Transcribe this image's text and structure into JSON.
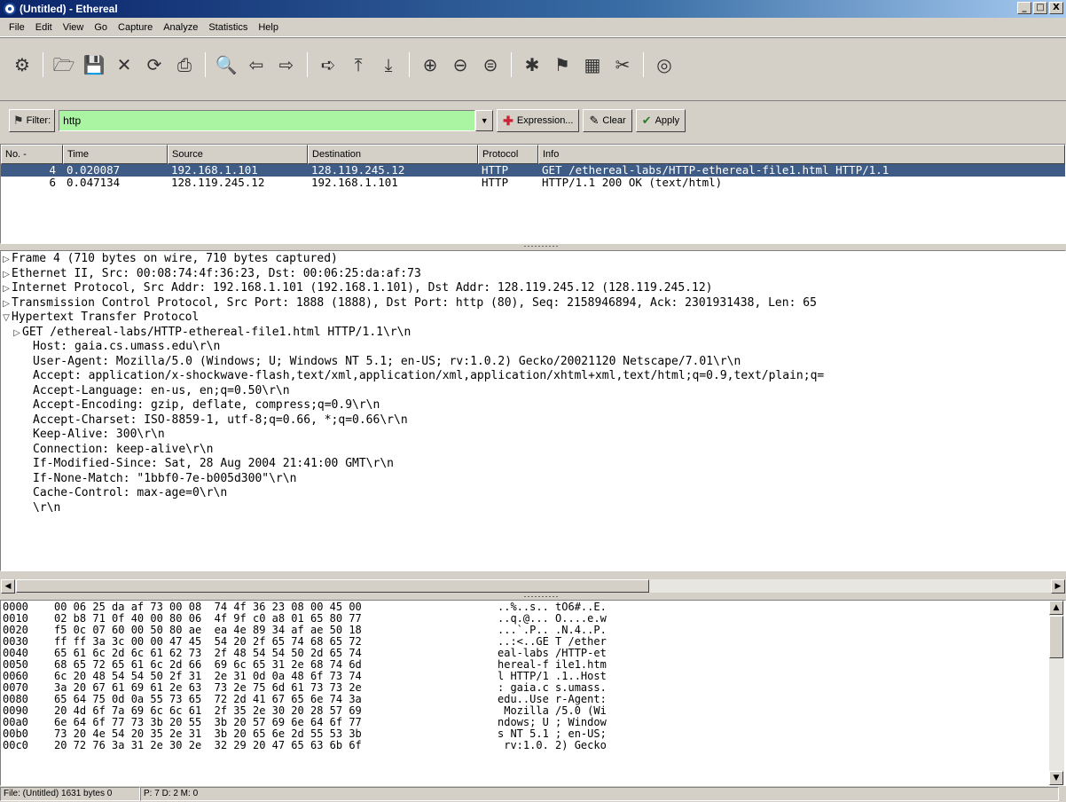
{
  "window": {
    "title": "(Untitled) - Ethereal",
    "buttons": [
      "_",
      "□",
      "X"
    ]
  },
  "menu": [
    "File",
    "Edit",
    "View",
    "Go",
    "Capture",
    "Analyze",
    "Statistics",
    "Help"
  ],
  "toolbar": {
    "icons": [
      {
        "name": "capture-interfaces-icon",
        "glyph": "⚙"
      },
      {
        "sep": true
      },
      {
        "name": "open-folder-icon",
        "glyph": "🗁"
      },
      {
        "name": "save-icon",
        "glyph": "💾"
      },
      {
        "name": "close-icon",
        "glyph": "✕"
      },
      {
        "name": "reload-icon",
        "glyph": "⟳"
      },
      {
        "name": "print-icon",
        "glyph": "⎙"
      },
      {
        "sep": true
      },
      {
        "name": "find-packet-icon",
        "glyph": "🔍"
      },
      {
        "name": "go-back-icon",
        "glyph": "⇦"
      },
      {
        "name": "go-forward-icon",
        "glyph": "⇨"
      },
      {
        "sep": true
      },
      {
        "name": "go-to-packet-icon",
        "glyph": "➪"
      },
      {
        "name": "go-first-icon",
        "glyph": "⤒"
      },
      {
        "name": "go-last-icon",
        "glyph": "⤓"
      },
      {
        "sep": true
      },
      {
        "name": "zoom-in-icon",
        "glyph": "⊕"
      },
      {
        "name": "zoom-out-icon",
        "glyph": "⊖"
      },
      {
        "name": "zoom-normal-icon",
        "glyph": "⊜"
      },
      {
        "sep": true
      },
      {
        "name": "capture-filter-icon",
        "glyph": "✱"
      },
      {
        "name": "display-filter-icon",
        "glyph": "⚑"
      },
      {
        "name": "coloring-rules-icon",
        "glyph": "▦"
      },
      {
        "name": "preferences-icon",
        "glyph": "✂"
      },
      {
        "sep": true
      },
      {
        "name": "help-icon",
        "glyph": "◎"
      }
    ]
  },
  "filter": {
    "label": "Filter:",
    "value": "http",
    "expression_label": "Expression...",
    "clear_label": "Clear",
    "apply_label": "Apply",
    "input_color": "#a9f5a2"
  },
  "packet_list": {
    "columns": [
      "No. -",
      "Time",
      "Source",
      "Destination",
      "Protocol",
      "Info"
    ],
    "rows": [
      {
        "no": "4",
        "time": "0.020087",
        "src": "192.168.1.101",
        "dst": "128.119.245.12",
        "proto": "HTTP",
        "info": "GET /ethereal-labs/HTTP-ethereal-file1.html HTTP/1.1",
        "selected": true
      },
      {
        "no": "6",
        "time": "0.047134",
        "src": "128.119.245.12",
        "dst": "192.168.1.101",
        "proto": "HTTP",
        "info": "HTTP/1.1 200 OK (text/html)",
        "selected": false
      }
    ],
    "selected_color": "#3e5c86"
  },
  "details": [
    {
      "tri": "▷",
      "indent": 0,
      "text": "Frame 4 (710 bytes on wire, 710 bytes captured)"
    },
    {
      "tri": "▷",
      "indent": 0,
      "text": "Ethernet II, Src: 00:08:74:4f:36:23, Dst: 00:06:25:da:af:73"
    },
    {
      "tri": "▷",
      "indent": 0,
      "text": "Internet Protocol, Src Addr: 192.168.1.101 (192.168.1.101), Dst Addr: 128.119.245.12 (128.119.245.12)"
    },
    {
      "tri": "▷",
      "indent": 0,
      "text": "Transmission Control Protocol, Src Port: 1888 (1888), Dst Port: http (80), Seq: 2158946894, Ack: 2301931438, Len: 65"
    },
    {
      "tri": "▽",
      "indent": 0,
      "text": "Hypertext Transfer Protocol"
    },
    {
      "tri": "▷",
      "indent": 1,
      "text": "GET /ethereal-labs/HTTP-ethereal-file1.html HTTP/1.1\\r\\n"
    },
    {
      "tri": "",
      "indent": 2,
      "text": "Host: gaia.cs.umass.edu\\r\\n"
    },
    {
      "tri": "",
      "indent": 2,
      "text": "User-Agent: Mozilla/5.0 (Windows; U; Windows NT 5.1; en-US; rv:1.0.2) Gecko/20021120 Netscape/7.01\\r\\n"
    },
    {
      "tri": "",
      "indent": 2,
      "text": "Accept: application/x-shockwave-flash,text/xml,application/xml,application/xhtml+xml,text/html;q=0.9,text/plain;q="
    },
    {
      "tri": "",
      "indent": 2,
      "text": "Accept-Language: en-us, en;q=0.50\\r\\n"
    },
    {
      "tri": "",
      "indent": 2,
      "text": "Accept-Encoding: gzip, deflate, compress;q=0.9\\r\\n"
    },
    {
      "tri": "",
      "indent": 2,
      "text": "Accept-Charset: ISO-8859-1, utf-8;q=0.66, *;q=0.66\\r\\n"
    },
    {
      "tri": "",
      "indent": 2,
      "text": "Keep-Alive: 300\\r\\n"
    },
    {
      "tri": "",
      "indent": 2,
      "text": "Connection: keep-alive\\r\\n"
    },
    {
      "tri": "",
      "indent": 2,
      "text": "If-Modified-Since: Sat, 28 Aug 2004 21:41:00 GMT\\r\\n"
    },
    {
      "tri": "",
      "indent": 2,
      "text": "If-None-Match: \"1bbf0-7e-b005d300\"\\r\\n"
    },
    {
      "tri": "",
      "indent": 2,
      "text": "Cache-Control: max-age=0\\r\\n"
    },
    {
      "tri": "",
      "indent": 2,
      "text": "\\r\\n"
    }
  ],
  "hex": [
    {
      "off": "0000",
      "bytes": "00 06 25 da af 73 00 08  74 4f 36 23 08 00 45 00",
      "ascii": "..%..s.. tO6#..E."
    },
    {
      "off": "0010",
      "bytes": "02 b8 71 0f 40 00 80 06  4f 9f c0 a8 01 65 80 77",
      "ascii": "..q.@... O....e.w"
    },
    {
      "off": "0020",
      "bytes": "f5 0c 07 60 00 50 80 ae  ea 4e 89 34 af ae 50 18",
      "ascii": "...`.P.. .N.4..P."
    },
    {
      "off": "0030",
      "bytes": "ff ff 3a 3c 00 00 47 45  54 20 2f 65 74 68 65 72",
      "ascii": "..:<..GE T /ether"
    },
    {
      "off": "0040",
      "bytes": "65 61 6c 2d 6c 61 62 73  2f 48 54 54 50 2d 65 74",
      "ascii": "eal-labs /HTTP-et"
    },
    {
      "off": "0050",
      "bytes": "68 65 72 65 61 6c 2d 66  69 6c 65 31 2e 68 74 6d",
      "ascii": "hereal-f ile1.htm"
    },
    {
      "off": "0060",
      "bytes": "6c 20 48 54 54 50 2f 31  2e 31 0d 0a 48 6f 73 74",
      "ascii": "l HTTP/1 .1..Host"
    },
    {
      "off": "0070",
      "bytes": "3a 20 67 61 69 61 2e 63  73 2e 75 6d 61 73 73 2e",
      "ascii": ": gaia.c s.umass."
    },
    {
      "off": "0080",
      "bytes": "65 64 75 0d 0a 55 73 65  72 2d 41 67 65 6e 74 3a",
      "ascii": "edu..Use r-Agent:"
    },
    {
      "off": "0090",
      "bytes": "20 4d 6f 7a 69 6c 6c 61  2f 35 2e 30 20 28 57 69",
      "ascii": " Mozilla /5.0 (Wi"
    },
    {
      "off": "00a0",
      "bytes": "6e 64 6f 77 73 3b 20 55  3b 20 57 69 6e 64 6f 77",
      "ascii": "ndows; U ; Window"
    },
    {
      "off": "00b0",
      "bytes": "73 20 4e 54 20 35 2e 31  3b 20 65 6e 2d 55 53 3b",
      "ascii": "s NT 5.1 ; en-US;"
    },
    {
      "off": "00c0",
      "bytes": "20 72 76 3a 31 2e 30 2e  32 29 20 47 65 63 6b 6f",
      "ascii": " rv:1.0. 2) Gecko"
    }
  ],
  "status": {
    "file": "File: (Untitled) 1631 bytes 0",
    "counts": "P: 7 D: 2 M: 0"
  }
}
